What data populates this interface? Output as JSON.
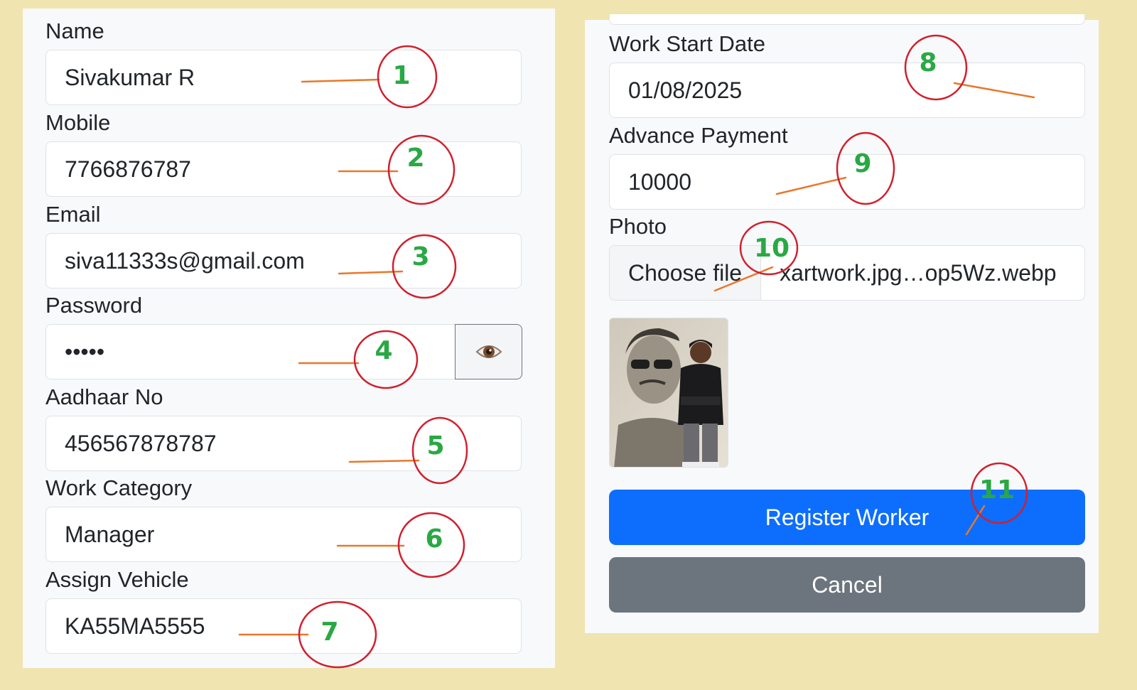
{
  "form_left": {
    "name": {
      "label": "Name",
      "value": "Sivakumar R"
    },
    "mobile": {
      "label": "Mobile",
      "value": "7766876787"
    },
    "email": {
      "label": "Email",
      "value": "siva11333s@gmail.com"
    },
    "password": {
      "label": "Password",
      "value": "•••••",
      "toggle_icon": "eye-icon"
    },
    "aadhaar": {
      "label": "Aadhaar No",
      "value": "456567878787"
    },
    "work_category": {
      "label": "Work Category",
      "value": "Manager"
    },
    "assign_vehicle": {
      "label": "Assign Vehicle",
      "value": "KA55MA5555"
    }
  },
  "form_right": {
    "work_start_date": {
      "label": "Work Start Date",
      "value": "01/08/2025"
    },
    "advance_payment": {
      "label": "Advance Payment",
      "value": "10000"
    },
    "photo": {
      "label": "Photo",
      "choose_label": "Choose file",
      "file_name": "xartwork.jpg…op5Wz.webp",
      "preview_icon": "photo-preview"
    },
    "register_button": "Register Worker",
    "cancel_button": "Cancel"
  },
  "annotations": [
    "1",
    "2",
    "3",
    "4",
    "5",
    "6",
    "7",
    "8",
    "9",
    "10",
    "11"
  ],
  "colors": {
    "background": "#f0e4b0",
    "primary": "#0d6efd",
    "secondary": "#6c757d",
    "annotation_circle": "#d0202e",
    "annotation_number": "#2aa845",
    "annotation_line": "#e8782a"
  }
}
